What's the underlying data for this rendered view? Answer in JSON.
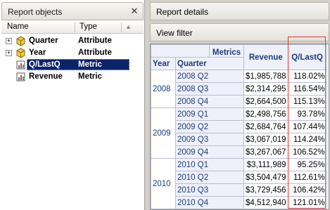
{
  "left_panel": {
    "title": "Report objects",
    "columns": {
      "name": "Name",
      "type": "Type"
    },
    "items": [
      {
        "label": "Quarter",
        "type": "Attribute",
        "expandable": true,
        "selected": false,
        "icon": "attribute-icon"
      },
      {
        "label": "Year",
        "type": "Attribute",
        "expandable": true,
        "selected": false,
        "icon": "attribute-icon"
      },
      {
        "label": "Q/LastQ",
        "type": "Metric",
        "expandable": false,
        "selected": true,
        "icon": "metric-icon"
      },
      {
        "label": "Revenue",
        "type": "Metric",
        "expandable": false,
        "selected": false,
        "icon": "metric-icon"
      }
    ]
  },
  "right_panel": {
    "details_title": "Report details",
    "filter_label": "View filter"
  },
  "grid": {
    "header": {
      "metrics": "Metrics",
      "year": "Year",
      "quarter": "Quarter",
      "revenue": "Revenue",
      "qlastq": "Q/LastQ"
    },
    "groups": [
      {
        "year": "2008",
        "rows": [
          {
            "quarter": "2008 Q2",
            "revenue": "$1,985,788",
            "qlastq": "118.02%"
          },
          {
            "quarter": "2008 Q3",
            "revenue": "$2,314,295",
            "qlastq": "116.54%"
          },
          {
            "quarter": "2008 Q4",
            "revenue": "$2,664,500",
            "qlastq": "115.13%"
          }
        ]
      },
      {
        "year": "2009",
        "rows": [
          {
            "quarter": "2009 Q1",
            "revenue": "$2,498,756",
            "qlastq": "93.78%"
          },
          {
            "quarter": "2009 Q2",
            "revenue": "$2,684,764",
            "qlastq": "107.44%"
          },
          {
            "quarter": "2009 Q3",
            "revenue": "$3,067,019",
            "qlastq": "114.24%"
          },
          {
            "quarter": "2009 Q4",
            "revenue": "$3,267,067",
            "qlastq": "106.52%"
          }
        ]
      },
      {
        "year": "2010",
        "rows": [
          {
            "quarter": "2010 Q1",
            "revenue": "$3,111,989",
            "qlastq": "95.25%"
          },
          {
            "quarter": "2010 Q2",
            "revenue": "$3,504,479",
            "qlastq": "112.61%"
          },
          {
            "quarter": "2010 Q3",
            "revenue": "$3,729,456",
            "qlastq": "106.42%"
          },
          {
            "quarter": "2010 Q4",
            "revenue": "$4,512,940",
            "qlastq": "121.01%"
          }
        ]
      }
    ]
  },
  "colors": {
    "header_text": "#1f3a84",
    "selection": "#0a246a",
    "highlight_box": "#e23a3a"
  }
}
